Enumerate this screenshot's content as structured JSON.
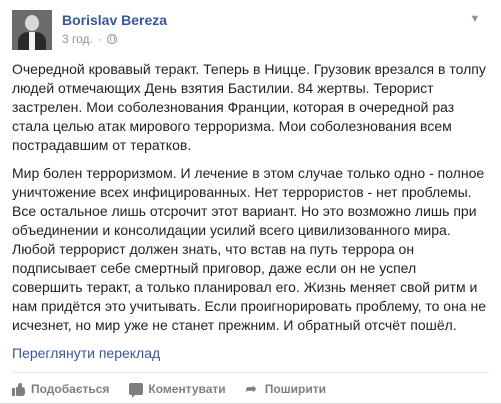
{
  "post": {
    "author": "Borislav Bereza",
    "time": "3 год.",
    "separator": "·",
    "paragraphs": [
      "Очередной кровавый теракт. Теперь в Ницце. Грузовик врезался в толпу людей отмечающих День взятия Бастилии. 84 жертвы. Терорист застрелен. Мои соболезнования Франции, которая в очередной раз стала целью атак мирового терроризма. Мои соболезнования всем пострадавшим от тератков.",
      "Мир болен терроризмом. И лечение в этом случае только одно - полное уничтожение всех инфицированных. Нет террористов - нет проблемы. Все остальное лишь отсрочит этот вариант. Но это возможно лишь при объединении и консолидации усилий всего цивилизованного мира. Любой террорист должен знать, что встав на путь террора он подписывает себе смертный приговор, даже если он не успел совершить теракт, а только планировал его. Жизнь меняет свой ритм и нам придётся это учитывать. Если проигнорировать проблему, то она не исчезнет, но мир уже не станет прежним. И обратный отсчёт пошёл."
    ],
    "translate_link": "Переглянути переклад"
  },
  "actions": {
    "like": "Подобається",
    "comment": "Коментувати",
    "share": "Поширити"
  },
  "icons": {
    "privacy": "globe-icon",
    "menu": "chevron-down-icon",
    "like": "thumbs-up-icon",
    "comment": "comment-icon",
    "share": "share-arrow-icon"
  },
  "colors": {
    "link": "#365899",
    "text": "#1d2129",
    "meta": "#90949c",
    "action": "#7f7f7f"
  }
}
